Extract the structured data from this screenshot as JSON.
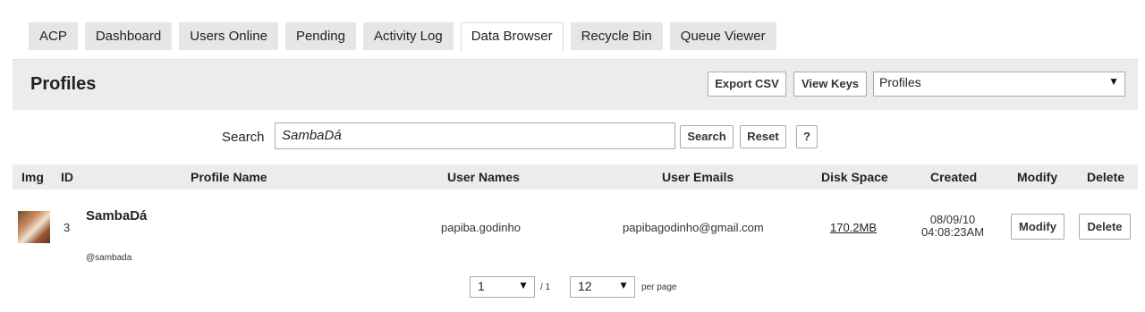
{
  "tabs": [
    "ACP",
    "Dashboard",
    "Users Online",
    "Pending",
    "Activity Log",
    "Data Browser",
    "Recycle Bin",
    "Queue Viewer"
  ],
  "active_tab": "Data Browser",
  "panel": {
    "title": "Profiles",
    "export_label": "Export CSV",
    "view_keys_label": "View Keys",
    "type_select": "Profiles"
  },
  "search": {
    "label": "Search",
    "value": "SambaDá",
    "search_button": "Search",
    "reset_button": "Reset",
    "help_button": "?"
  },
  "table": {
    "headers": {
      "img": "Img",
      "id": "ID",
      "profile_name": "Profile Name",
      "user_names": "User Names",
      "user_emails": "User Emails",
      "disk_space": "Disk Space",
      "created": "Created",
      "modify": "Modify",
      "delete": "Delete"
    },
    "rows": [
      {
        "id": "3",
        "profile_name": "SambaDá",
        "handle": "@sambada",
        "user_name": "papiba.godinho",
        "user_email": "papibagodinho@gmail.com",
        "disk_space": "170.2MB",
        "created_date": "08/09/10",
        "created_time": "04:08:23AM",
        "modify_label": "Modify",
        "delete_label": "Delete"
      }
    ]
  },
  "pagination": {
    "page": "1",
    "total_pages": "/ 1",
    "per_page_value": "12",
    "per_page_label": "per page"
  }
}
